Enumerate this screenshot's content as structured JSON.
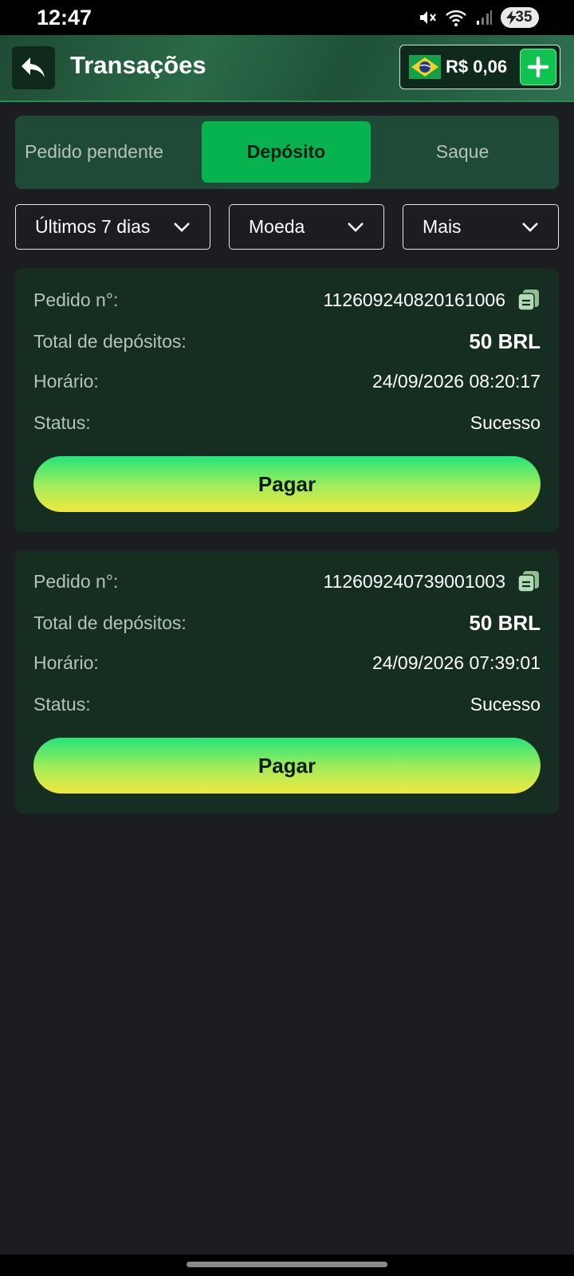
{
  "status_bar": {
    "time": "12:47",
    "battery": "35"
  },
  "header": {
    "title": "Transações",
    "balance": "R$ 0,06"
  },
  "tabs": [
    {
      "label": "Pedido pendente",
      "active": false
    },
    {
      "label": "Depósito",
      "active": true
    },
    {
      "label": "Saque",
      "active": false
    }
  ],
  "filters": {
    "period": "Últimos 7 dias",
    "currency": "Moeda",
    "more": "Mais"
  },
  "labels": {
    "order": "Pedido n°:",
    "total": "Total de depósitos:",
    "time": "Horário:",
    "status": "Status:"
  },
  "transactions": [
    {
      "order_no": "112609240820161006",
      "total": "50 BRL",
      "datetime": "24/09/2026 08:20:17",
      "status": "Sucesso",
      "pay_label": "Pagar"
    },
    {
      "order_no": "112609240739001003",
      "total": "50 BRL",
      "datetime": "24/09/2026 07:39:01",
      "status": "Sucesso",
      "pay_label": "Pagar"
    }
  ],
  "colors": {
    "accent": "#07b34e",
    "background": "#1c1d21",
    "card": "#162d22",
    "tab_bar": "#1f4a37"
  },
  "icons": {
    "back": "back-arrow-icon",
    "flag": "brazil-flag-icon",
    "add": "plus-icon",
    "chevron": "chevron-down-icon",
    "copy": "copy-icon"
  }
}
